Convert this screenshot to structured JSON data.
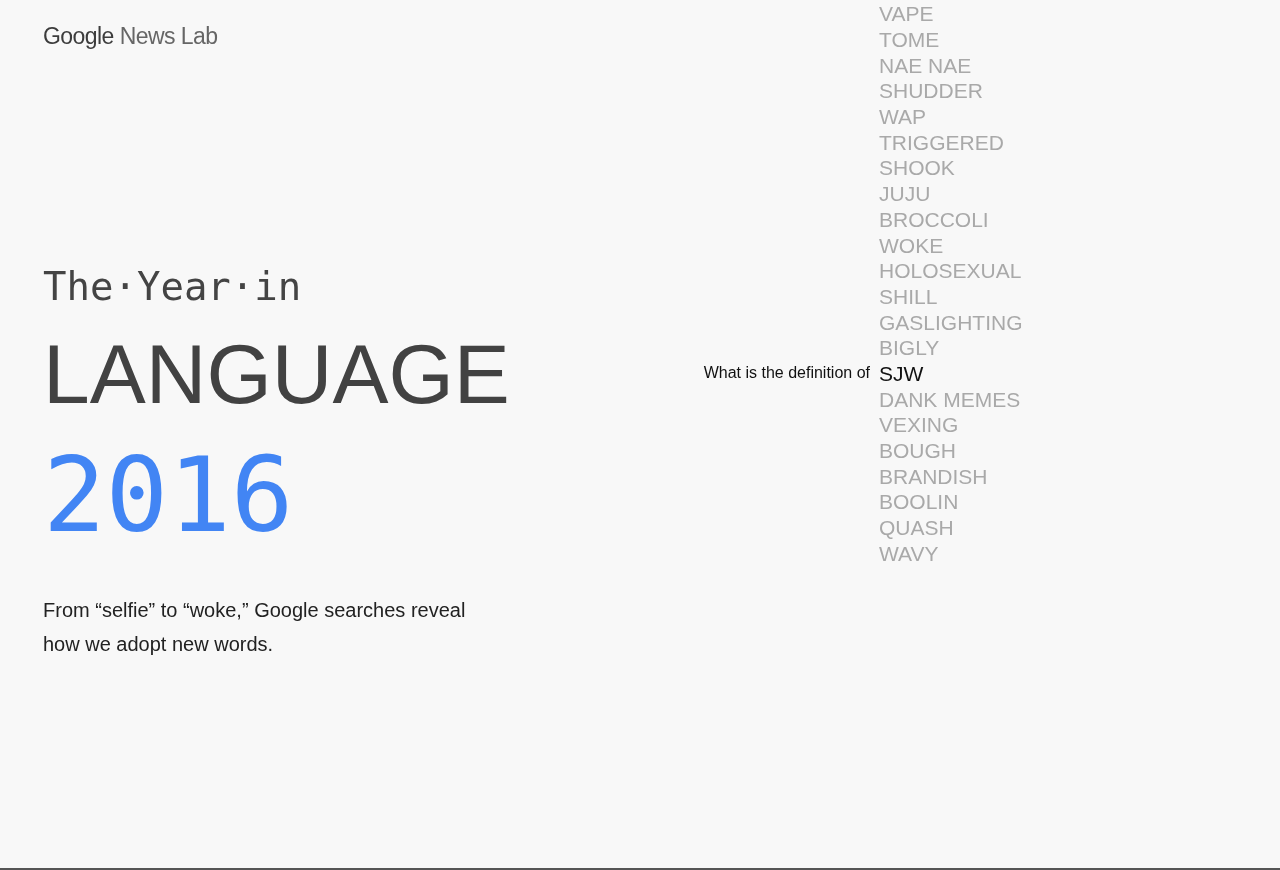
{
  "logo": {
    "brand": "Google",
    "product": "News Lab"
  },
  "title": {
    "kicker": "The·Year·in",
    "headline": "LANGUAGE",
    "year": "2016"
  },
  "subtitle": "From “selfie” to “woke,” Google searches reveal how we adopt new words.",
  "prompt": "What is the definition of",
  "words": [
    {
      "label": "VAPE",
      "selected": false
    },
    {
      "label": "TOME",
      "selected": false
    },
    {
      "label": "NAE NAE",
      "selected": false
    },
    {
      "label": "SHUDDER",
      "selected": false
    },
    {
      "label": "WAP",
      "selected": false
    },
    {
      "label": "TRIGGERED",
      "selected": false
    },
    {
      "label": "SHOOK",
      "selected": false
    },
    {
      "label": "JUJU",
      "selected": false
    },
    {
      "label": "BROCCOLI",
      "selected": false
    },
    {
      "label": "WOKE",
      "selected": false
    },
    {
      "label": "HOLOSEXUAL",
      "selected": false
    },
    {
      "label": "SHILL",
      "selected": false
    },
    {
      "label": "GASLIGHTING",
      "selected": false
    },
    {
      "label": "BIGLY",
      "selected": false
    },
    {
      "label": "SJW",
      "selected": true
    },
    {
      "label": "DANK MEMES",
      "selected": false
    },
    {
      "label": "VEXING",
      "selected": false
    },
    {
      "label": "BOUGH",
      "selected": false
    },
    {
      "label": "BRANDISH",
      "selected": false
    },
    {
      "label": "BOOLIN",
      "selected": false
    },
    {
      "label": "QUASH",
      "selected": false
    },
    {
      "label": "WAVY",
      "selected": false
    }
  ]
}
